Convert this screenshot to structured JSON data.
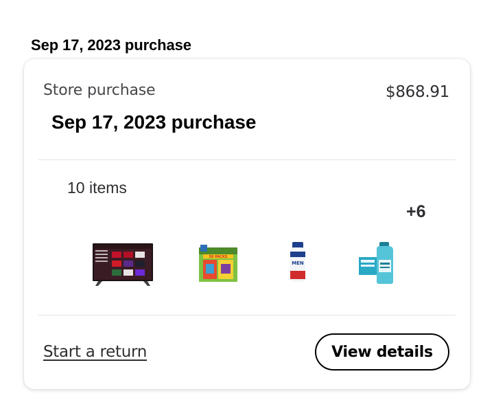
{
  "page": {
    "heading": "Sep 17, 2023 purchase"
  },
  "order": {
    "type_label": "Store purchase",
    "total": "$868.91",
    "heading": "Sep 17, 2023 purchase",
    "items_count": "10 items",
    "more_items": "+6",
    "products": [
      {
        "icon": "tv-icon"
      },
      {
        "icon": "snack-box-icon"
      },
      {
        "icon": "shampoo-bottle-icon"
      },
      {
        "icon": "mouthwash-icon"
      }
    ],
    "actions": {
      "return_label": "Start a return",
      "details_label": "View details"
    }
  }
}
